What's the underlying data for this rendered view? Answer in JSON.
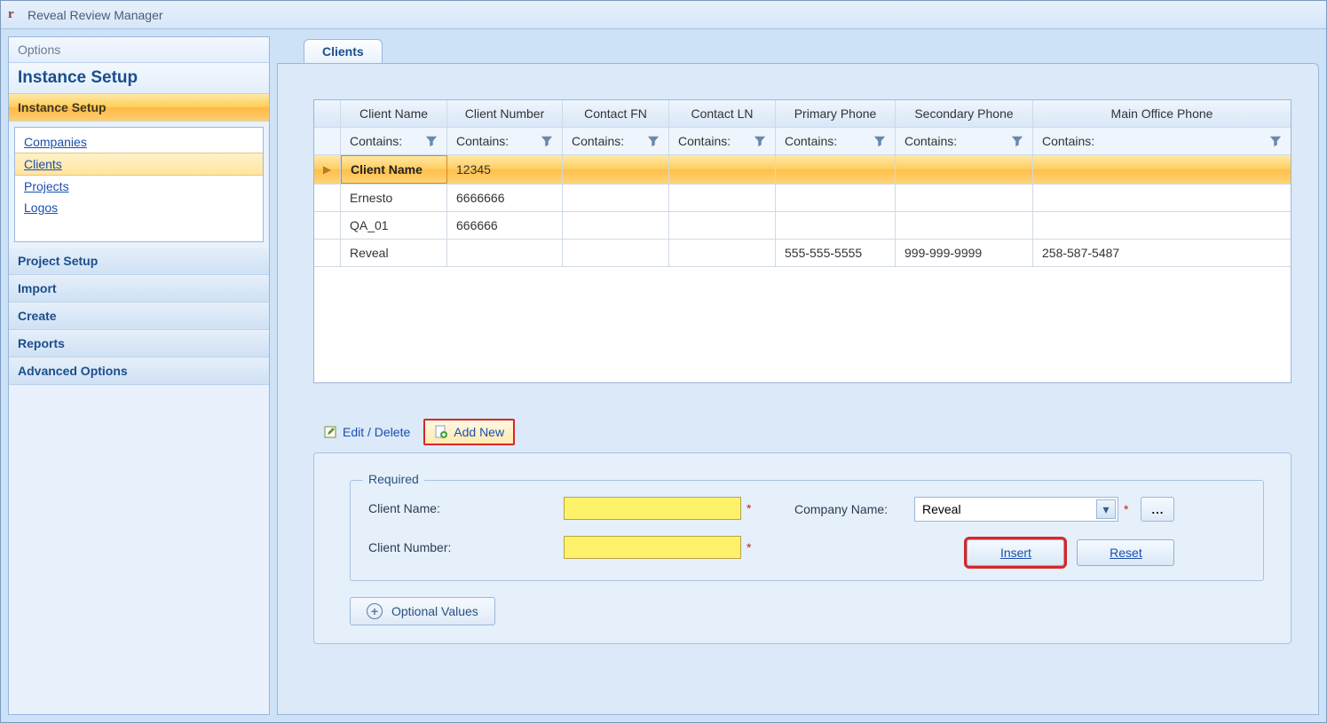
{
  "titlebar": {
    "title": "Reveal Review Manager"
  },
  "sidebar": {
    "options": "Options",
    "title": "Instance Setup",
    "sections": [
      {
        "label": "Instance Setup",
        "active": true
      },
      {
        "label": "Project Setup"
      },
      {
        "label": "Import"
      },
      {
        "label": "Create"
      },
      {
        "label": "Reports"
      },
      {
        "label": "Advanced Options"
      }
    ],
    "links": [
      {
        "label": "Companies"
      },
      {
        "label": "Clients",
        "selected": true
      },
      {
        "label": "Projects"
      },
      {
        "label": "Logos"
      }
    ]
  },
  "tabs": [
    {
      "label": "Clients"
    }
  ],
  "grid": {
    "columns": [
      "Client Name",
      "Client Number",
      "Contact FN",
      "Contact LN",
      "Primary Phone",
      "Secondary Phone",
      "Main Office Phone"
    ],
    "filter_label": "Contains:",
    "rows": [
      {
        "selected": true,
        "cells": [
          "Client Name",
          "12345",
          "",
          "",
          "",
          "",
          ""
        ]
      },
      {
        "cells": [
          "Ernesto",
          "6666666",
          "",
          "",
          "",
          "",
          ""
        ]
      },
      {
        "cells": [
          "QA_01",
          "666666",
          "",
          "",
          "",
          "",
          ""
        ]
      },
      {
        "cells": [
          "Reveal",
          "",
          "",
          "",
          "555-555-5555",
          "999-999-9999",
          "258-587-5487"
        ]
      }
    ]
  },
  "toolbar": {
    "edit_delete": "Edit / Delete",
    "add_new": "Add New"
  },
  "form": {
    "required_legend": "Required",
    "client_name_label": "Client Name:",
    "client_number_label": "Client Number:",
    "company_name_label": "Company Name:",
    "company_name_value": "Reveal",
    "ellipsis": "...",
    "insert": "Insert",
    "reset": "Reset",
    "optional": "Optional Values"
  }
}
